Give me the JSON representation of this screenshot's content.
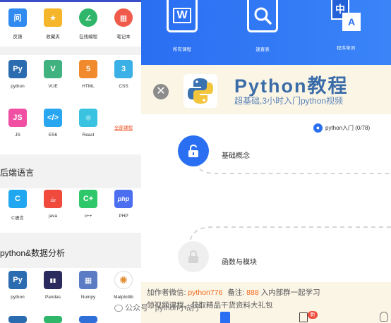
{
  "left": {
    "row1": [
      {
        "label": "反馈",
        "icon": "feedback-icon",
        "color": "#2f8bf0",
        "glyph": "问"
      },
      {
        "label": "收藏夹",
        "icon": "folder-icon",
        "color": "#f5b62b",
        "glyph": "★"
      },
      {
        "label": "在线编程",
        "icon": "online-coding-icon",
        "color": "#2fb66a",
        "glyph": "∠"
      },
      {
        "label": "笔记本",
        "icon": "notebook-icon",
        "color": "#ef5a4a",
        "glyph": "▦"
      }
    ],
    "row2": [
      {
        "label": "python",
        "icon": "python-icon",
        "color": "#2b6cb0",
        "glyph": "Py"
      },
      {
        "label": "VUE",
        "icon": "vue-icon",
        "color": "#3fb27f",
        "glyph": "V"
      },
      {
        "label": "HTML",
        "icon": "html5-icon",
        "color": "#f08a2c",
        "glyph": "5"
      },
      {
        "label": "CSS",
        "icon": "css3-icon",
        "color": "#3ab0e6",
        "glyph": "3"
      }
    ],
    "row3": [
      {
        "label": "JS",
        "icon": "javascript-icon",
        "color": "#f04fa2",
        "glyph": "JS"
      },
      {
        "label": "ES6",
        "icon": "es6-icon",
        "color": "#29a6f0",
        "glyph": "</>"
      },
      {
        "label": "React",
        "icon": "react-icon",
        "color": "#39c3e0",
        "glyph": "⚛"
      },
      {
        "label": "全部课程",
        "icon": "",
        "color": "",
        "glyph": ""
      }
    ],
    "section_backend": "后端语言",
    "row4": [
      {
        "label": "C语言",
        "icon": "c-language-icon",
        "color": "#20a7f0",
        "glyph": "C"
      },
      {
        "label": "java",
        "icon": "java-icon",
        "color": "#ef4a3c",
        "glyph": "☕"
      },
      {
        "label": "c++",
        "icon": "cpp-icon",
        "color": "#2ec86a",
        "glyph": "C+"
      },
      {
        "label": "PHP",
        "icon": "php-icon",
        "color": "#4b6ff0",
        "glyph": "php"
      }
    ],
    "section_python": "python&数据分析",
    "row5": [
      {
        "label": "python",
        "icon": "python-icon",
        "color": "#2b6cb0",
        "glyph": "Py"
      },
      {
        "label": "Pandas",
        "icon": "pandas-icon",
        "color": "#2a2a5e",
        "glyph": "▮▮"
      },
      {
        "label": "Numpy",
        "icon": "numpy-icon",
        "color": "#5b7cc4",
        "glyph": "▦"
      },
      {
        "label": "Matplotlib",
        "icon": "matplotlib-icon",
        "color": "#ffffff",
        "glyph": "✺"
      }
    ]
  },
  "header": {
    "items": [
      {
        "label": "所有课程",
        "icon": "all-courses-icon",
        "glyph": "W"
      },
      {
        "label": "速查表",
        "icon": "search-table-icon",
        "glyph": "🔍"
      },
      {
        "label": "程序单词",
        "icon": "program-words-icon",
        "glyph": "中A"
      }
    ]
  },
  "banner": {
    "title": "Python教程",
    "subtitle": "超基础,3小时入门python视频"
  },
  "progress": {
    "text": "python入门 (0/78)"
  },
  "lessons": [
    {
      "label": "基础概念",
      "state": "active"
    },
    {
      "label": "函数与模块",
      "state": "locked"
    }
  ],
  "footer": {
    "line1_prefix": "加作者微信:",
    "wechat": "python776",
    "note_label": "备注:",
    "note_value": "888",
    "line1_suffix": "入内部群一起学习",
    "line2": "领视频课程，获取精品干货资料大礼包"
  },
  "watermark": "公众号 · python小胡子",
  "bottom_nav": {
    "badge": "新"
  }
}
